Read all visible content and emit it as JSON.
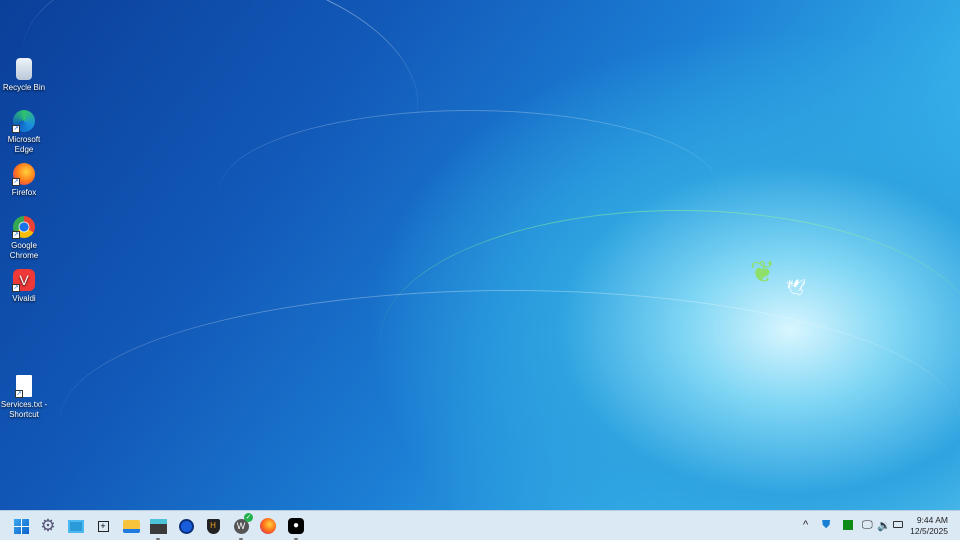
{
  "desktop": {
    "icons": [
      {
        "label": "Recycle Bin",
        "icon": "recycle-bin-icon"
      },
      {
        "label": "Microsoft Edge",
        "icon": "edge-icon"
      },
      {
        "label": "Firefox",
        "icon": "firefox-icon"
      },
      {
        "label": "Google Chrome",
        "icon": "chrome-icon"
      },
      {
        "label": "Vivaldi",
        "icon": "vivaldi-icon"
      },
      {
        "label": "Services.txt - Shortcut",
        "icon": "text-file-icon"
      }
    ]
  },
  "taskbar": {
    "apps": [
      "start",
      "settings",
      "remote-desktop",
      "snipping",
      "file-explorer",
      "terminal",
      "bitwarden",
      "security",
      "wordpress",
      "firefox",
      "ghost"
    ]
  },
  "tray": {
    "time": "9:44 AM",
    "date": "12/5/2025"
  }
}
